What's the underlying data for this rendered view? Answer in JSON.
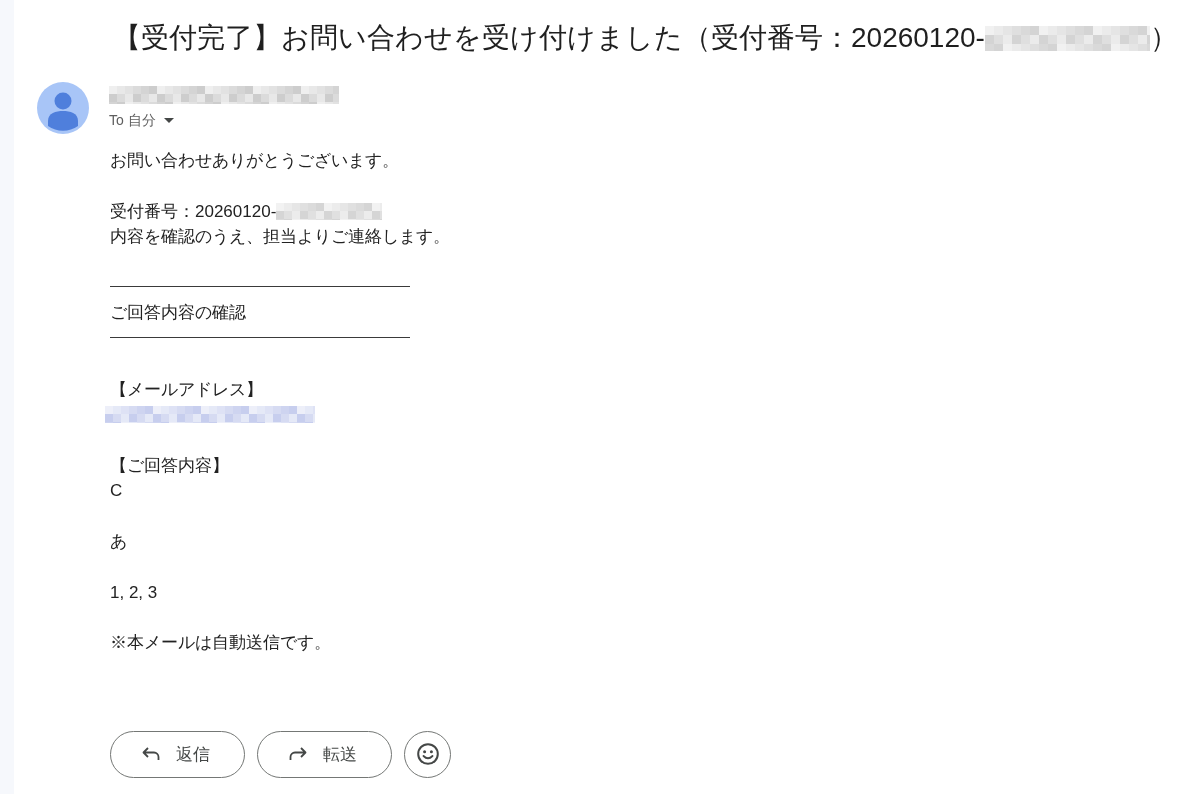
{
  "subject": {
    "text": "【受付完了】お問い合わせを受け付けました（受付番号：20260120-",
    "redacted": true,
    "closing": "）"
  },
  "sender": {
    "redacted": true
  },
  "recipient": {
    "label": "To 自分"
  },
  "body": [
    {
      "lines": [
        {
          "kind": "text",
          "text": "お問い合わせありがとうございます。",
          "redacted": false
        }
      ]
    },
    {
      "lines": [
        {
          "kind": "text",
          "text": "受付番号：20260120-",
          "redacted": true
        },
        {
          "kind": "text",
          "text": "内容を確認のうえ、担当よりご連絡します。",
          "redacted": false
        }
      ]
    },
    {
      "lines": [
        {
          "kind": "rule"
        },
        {
          "kind": "text",
          "text": "ご回答内容の確認",
          "redacted": false
        },
        {
          "kind": "rule"
        }
      ]
    },
    {
      "lines": [
        {
          "kind": "text",
          "text": "【メールアドレス】",
          "redacted": false
        },
        {
          "kind": "link",
          "redacted": true
        }
      ]
    },
    {
      "lines": [
        {
          "kind": "text",
          "text": "【ご回答内容】",
          "redacted": false
        },
        {
          "kind": "text",
          "text": "C",
          "redacted": false
        }
      ]
    },
    {
      "lines": [
        {
          "kind": "text",
          "text": "あ",
          "redacted": false
        }
      ]
    },
    {
      "lines": [
        {
          "kind": "text",
          "text": "1, 2, 3",
          "redacted": false
        }
      ]
    },
    {
      "lines": [
        {
          "kind": "text",
          "text": "※本メールは自動送信です。",
          "redacted": false
        }
      ]
    }
  ],
  "actions": [
    {
      "kind": "reply",
      "label": "返信"
    },
    {
      "kind": "forward",
      "label": "転送"
    },
    {
      "kind": "emoji"
    }
  ]
}
